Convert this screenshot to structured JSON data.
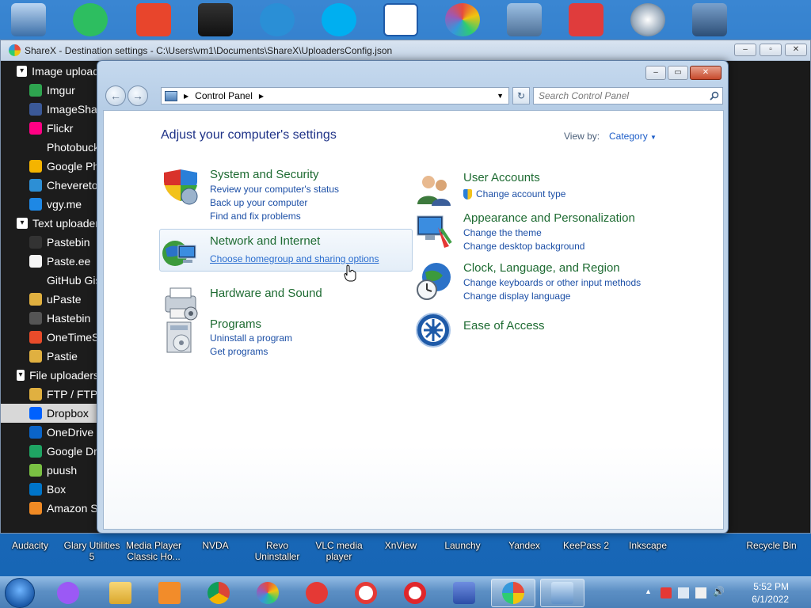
{
  "sharex": {
    "window_title": "ShareX - Destination settings - C:\\Users\\vm1\\Documents\\ShareX\\UploadersConfig.json",
    "tree": [
      {
        "type": "group",
        "label": "Image upload",
        "icon": "image-icon"
      },
      {
        "type": "child",
        "label": "Imgur",
        "icon": "imgur-icon",
        "color": "#2ea44f"
      },
      {
        "type": "child",
        "label": "ImageSha",
        "icon": "imageshack-icon",
        "color": "#3b5998"
      },
      {
        "type": "child",
        "label": "Flickr",
        "icon": "flickr-icon",
        "color": "#ff0084"
      },
      {
        "type": "child",
        "label": "Photobuck",
        "icon": "photobucket-icon",
        "color": "#1c1c1c"
      },
      {
        "type": "child",
        "label": "Google Ph",
        "icon": "google-photos-icon",
        "color": "#f4b400"
      },
      {
        "type": "child",
        "label": "Chevereto",
        "icon": "chevereto-icon",
        "color": "#2d8fd5"
      },
      {
        "type": "child",
        "label": "vgy.me",
        "icon": "vgyme-icon",
        "color": "#1e88e5"
      },
      {
        "type": "group",
        "label": "Text uploader",
        "icon": "text-icon"
      },
      {
        "type": "child",
        "label": "Pastebin",
        "icon": "pastebin-icon",
        "color": "#333333"
      },
      {
        "type": "child",
        "label": "Paste.ee",
        "icon": "pasteee-icon",
        "color": "#f5f5f5"
      },
      {
        "type": "child",
        "label": "GitHub Gis",
        "icon": "github-icon",
        "color": "#1c1c1c"
      },
      {
        "type": "child",
        "label": "uPaste",
        "icon": "upaste-icon",
        "color": "#e0b040"
      },
      {
        "type": "child",
        "label": "Hastebin",
        "icon": "hastebin-icon",
        "color": "#555555"
      },
      {
        "type": "child",
        "label": "OneTimeS",
        "icon": "onetimesecret-icon",
        "color": "#e84b2a"
      },
      {
        "type": "child",
        "label": "Pastie",
        "icon": "pastie-icon",
        "color": "#e0b040"
      },
      {
        "type": "group",
        "label": "File uploaders",
        "icon": "file-icon"
      },
      {
        "type": "child",
        "label": "FTP / FTP",
        "icon": "ftp-icon",
        "color": "#e0b040"
      },
      {
        "type": "child",
        "label": "Dropbox",
        "icon": "dropbox-icon",
        "color": "#0061fe",
        "selected": true
      },
      {
        "type": "child",
        "label": "OneDrive",
        "icon": "onedrive-icon",
        "color": "#0a64c8"
      },
      {
        "type": "child",
        "label": "Google Dr",
        "icon": "google-drive-icon",
        "color": "#1fa463"
      },
      {
        "type": "child",
        "label": "puush",
        "icon": "puush-icon",
        "color": "#7ac143"
      },
      {
        "type": "child",
        "label": "Box",
        "icon": "box-icon",
        "color": "#0075c9"
      },
      {
        "type": "child",
        "label": "Amazon S:",
        "icon": "amazon-s3-icon",
        "color": "#f08a24"
      }
    ]
  },
  "control_panel": {
    "address_segment": "Control Panel",
    "search_placeholder": "Search Control Panel",
    "heading": "Adjust your computer's settings",
    "view_by_label": "View by:",
    "view_by_value": "Category",
    "categories": {
      "system_security": {
        "title": "System and Security",
        "links": [
          "Review your computer's status",
          "Back up your computer",
          "Find and fix problems"
        ]
      },
      "network": {
        "title": "Network and Internet",
        "links": [
          "Choose homegroup and sharing options"
        ]
      },
      "hardware": {
        "title": "Hardware and Sound",
        "links": []
      },
      "programs": {
        "title": "Programs",
        "links": [
          "Uninstall a program",
          "Get programs"
        ]
      },
      "user_accounts": {
        "title": "User Accounts",
        "links": [
          "Change account type"
        ]
      },
      "appearance": {
        "title": "Appearance and Personalization",
        "links": [
          "Change the theme",
          "Change desktop background"
        ]
      },
      "clock": {
        "title": "Clock, Language, and Region",
        "links": [
          "Change keyboards or other input methods",
          "Change display language"
        ]
      },
      "ease": {
        "title": "Ease of Access",
        "links": []
      }
    }
  },
  "desktop_labels": [
    "Audacity",
    "Glary Utilities 5",
    "Media Player Classic Ho...",
    "NVDA",
    "Revo Uninstaller",
    "VLC media player",
    "XnView",
    "Launchy",
    "Yandex",
    "KeePass 2",
    "Inkscape",
    "Recycle Bin"
  ],
  "clock": {
    "time": "5:52 PM",
    "date": "6/1/2022"
  }
}
